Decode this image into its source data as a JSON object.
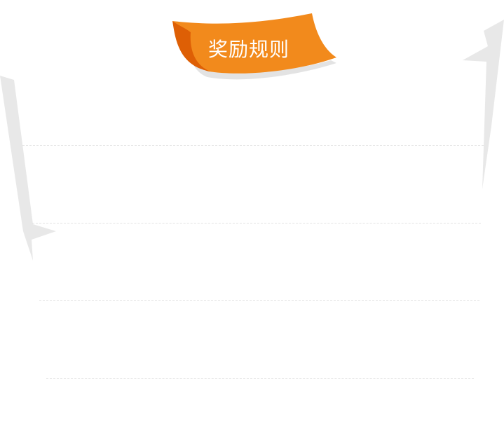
{
  "banner": {
    "title": "奖励规则",
    "colors": {
      "fill": "#f28a1c",
      "fold": "#de5f05",
      "shadow": "#e3e3e3"
    }
  },
  "paper": {
    "edge_color": "#e8e8e8",
    "line_color": "#e3e3e3",
    "ruled_lines": 4
  }
}
